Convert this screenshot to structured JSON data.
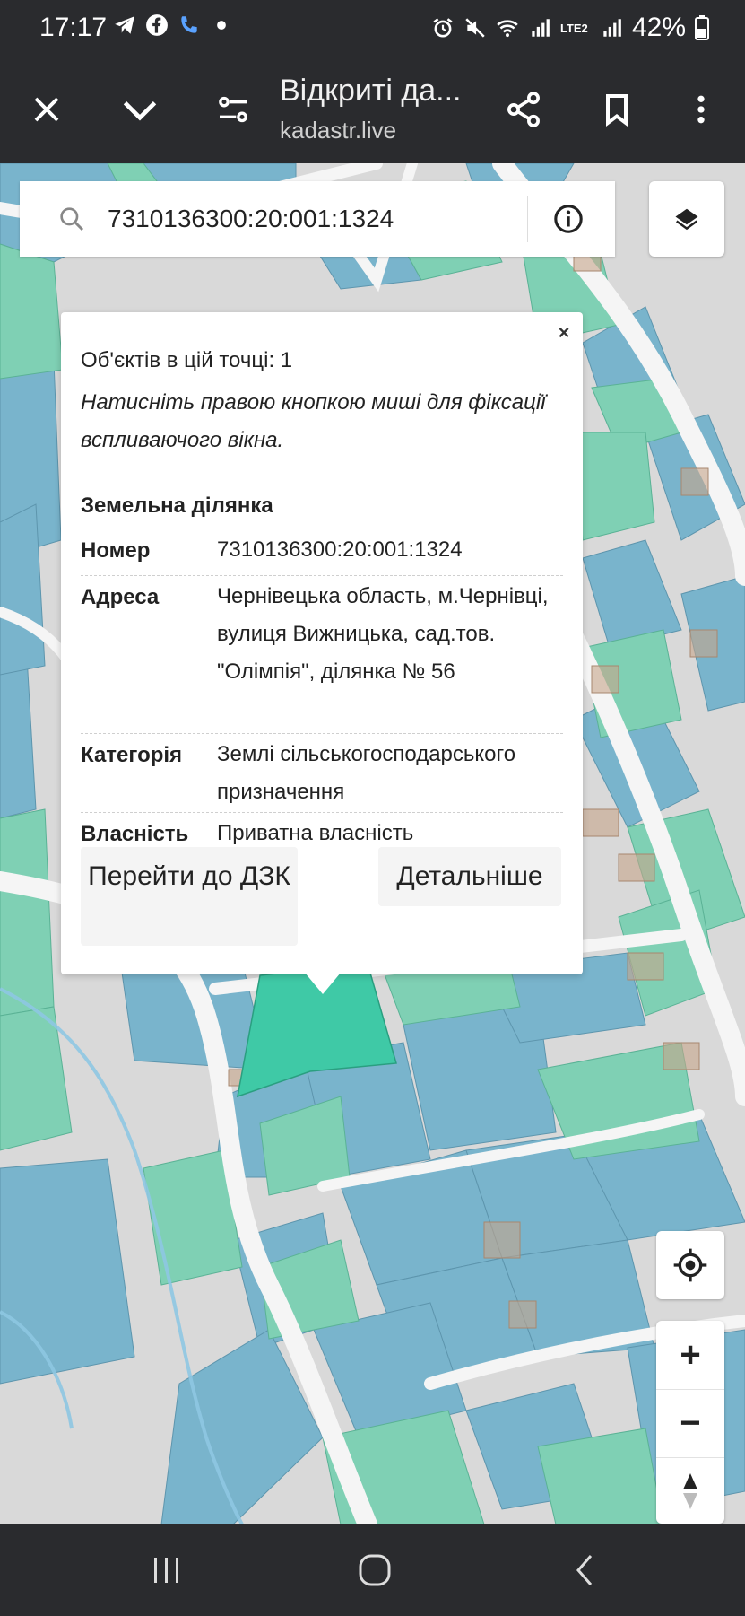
{
  "status_bar": {
    "time": "17:17",
    "battery": "42%",
    "network": "LTE2",
    "left_icons": [
      "telegram-icon",
      "facebook-icon",
      "phone-call-icon",
      "dot-icon"
    ],
    "right_icons": [
      "alarm-icon",
      "mute-icon",
      "wifi-icon",
      "signal-icon",
      "battery-icon"
    ]
  },
  "browser": {
    "title": "Відкриті да...",
    "url": "kadastr.live"
  },
  "search": {
    "value": "7310136300:20:001:1324"
  },
  "popup": {
    "count_text": "Об'єктів в цій точці: 1",
    "hint": "Натисніть правою кнопкою миші для фіксації вспливаючого вікна.",
    "section_title": "Земельна ділянка",
    "props": [
      {
        "key": "Номер",
        "value": "7310136300:20:001:1324"
      },
      {
        "key": "Адреса",
        "value": "Чернівецька область, м.Чернівці, вулиця Вижницька, сад.тов. \"Олімпія\", ділянка № 56"
      },
      {
        "key": "Категорія",
        "value": "Землі сільськогосподарського призначення"
      },
      {
        "key": "Власність",
        "value": "Приватна власність"
      }
    ],
    "buttons": {
      "goto": "Перейти до ДЗК",
      "details": "Детальніше"
    },
    "close": "×"
  },
  "map_controls": {
    "zoom_in": "+",
    "zoom_out": "−"
  },
  "colors": {
    "bar": "#2a2b2e",
    "parcel_blue": "#79b4cc",
    "parcel_green": "#7fd0b4",
    "parcel_selected": "#3fc9a6",
    "road": "#f5f5f5",
    "map_bg": "#d9d9d9"
  }
}
